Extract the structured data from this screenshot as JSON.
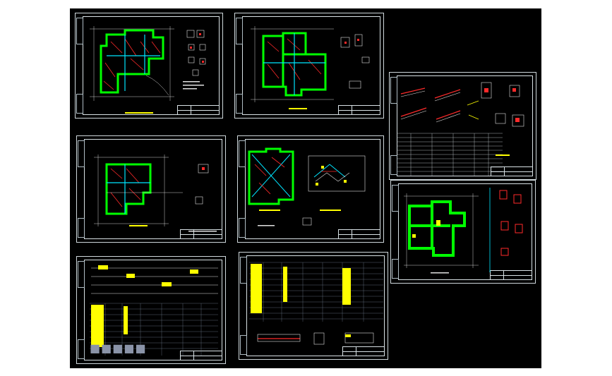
{
  "viewer": {
    "background": "#000000",
    "frame_color": "#cfd8dc",
    "accent_green": "#00ff00",
    "accent_yellow": "#ffff00",
    "accent_cyan": "#00e5ff",
    "accent_red": "#ff2a2a"
  },
  "sheets": [
    {
      "id": "sheet-1",
      "kind": "foundation-plan"
    },
    {
      "id": "sheet-2",
      "kind": "floor-plan"
    },
    {
      "id": "sheet-3",
      "kind": "beam-details"
    },
    {
      "id": "sheet-4",
      "kind": "floor-plan"
    },
    {
      "id": "sheet-5",
      "kind": "roof-plan"
    },
    {
      "id": "sheet-6",
      "kind": "column-plan"
    },
    {
      "id": "sheet-7",
      "kind": "schedule-table"
    },
    {
      "id": "sheet-8",
      "kind": "schedule-table"
    }
  ],
  "watermark": {
    "text": "■■■■■",
    "color": "#8a93a8"
  }
}
